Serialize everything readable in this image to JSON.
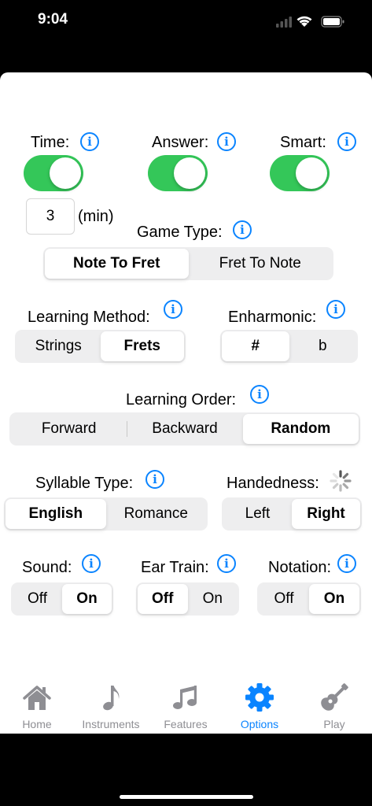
{
  "status": {
    "time": "9:04"
  },
  "top": {
    "time": {
      "label": "Time:",
      "on": true
    },
    "answer": {
      "label": "Answer:",
      "on": true
    },
    "smart": {
      "label": "Smart:",
      "on": true
    },
    "minutes_value": "3",
    "minutes_unit": "(min)"
  },
  "game_type": {
    "label": "Game Type:",
    "options": [
      "Note To Fret",
      "Fret To Note"
    ],
    "selected": "Note To Fret"
  },
  "learning_method": {
    "label": "Learning Method:",
    "options": [
      "Strings",
      "Frets"
    ],
    "selected": "Frets"
  },
  "enharmonic": {
    "label": "Enharmonic:",
    "options": [
      "#",
      "b"
    ],
    "selected": "#"
  },
  "learning_order": {
    "label": "Learning Order:",
    "options": [
      "Forward",
      "Backward",
      "Random"
    ],
    "selected": "Random"
  },
  "syllable_type": {
    "label": "Syllable Type:",
    "options": [
      "English",
      "Romance"
    ],
    "selected": "English"
  },
  "handedness": {
    "label": "Handedness:",
    "options": [
      "Left",
      "Right"
    ],
    "selected": "Right"
  },
  "sound": {
    "label": "Sound:",
    "options": [
      "Off",
      "On"
    ],
    "selected": "On"
  },
  "ear_train": {
    "label": "Ear Train:",
    "options": [
      "Off",
      "On"
    ],
    "selected": "Off"
  },
  "notation": {
    "label": "Notation:",
    "options": [
      "Off",
      "On"
    ],
    "selected": "On"
  },
  "info_glyph": "i",
  "tabs": [
    {
      "label": "Home",
      "icon": "house-icon"
    },
    {
      "label": "Instruments",
      "icon": "music-note-icon"
    },
    {
      "label": "Features",
      "icon": "music-notes-icon"
    },
    {
      "label": "Options",
      "icon": "gear-icon",
      "active": true
    },
    {
      "label": "Play",
      "icon": "guitar-icon"
    }
  ],
  "colors": {
    "accent": "#0a84ff",
    "toggle_on": "#34c759",
    "tab_inactive": "#8e8e93"
  }
}
